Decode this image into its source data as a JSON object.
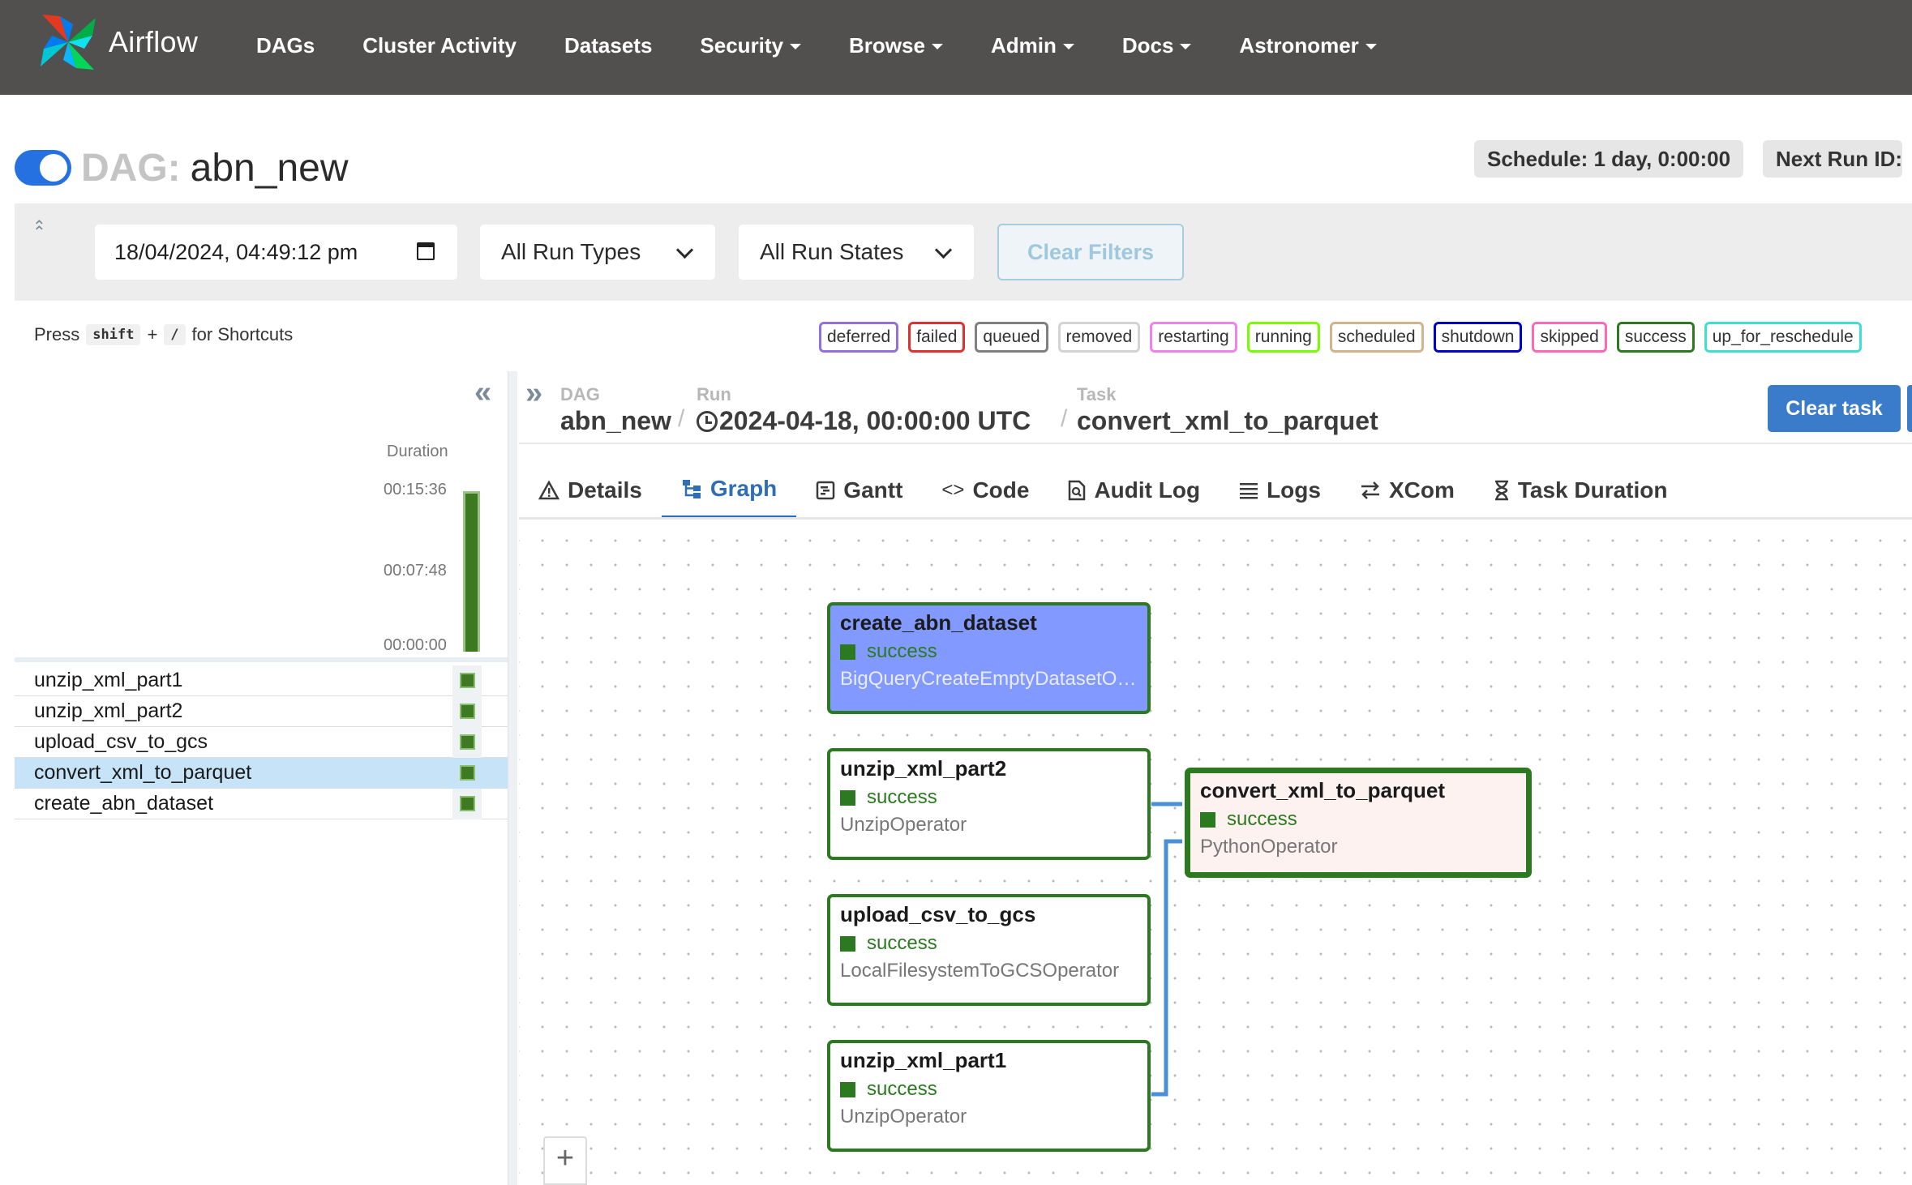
{
  "app": {
    "brand": "Airflow",
    "nav": [
      "DAGs",
      "Cluster Activity",
      "Datasets",
      "Security",
      "Browse",
      "Admin",
      "Docs",
      "Astronomer"
    ],
    "nav_dropdowns": [
      false,
      false,
      false,
      true,
      true,
      true,
      true,
      true
    ]
  },
  "dag": {
    "prefix": "DAG:",
    "name": "abn_new",
    "paused": false,
    "schedule": "Schedule: 1 day, 0:00:00",
    "next_run": "Next Run ID:"
  },
  "filters": {
    "date": "18/04/2024, 04:49:12 pm",
    "run_types": "All Run Types",
    "run_states": "All Run States",
    "clear_label": "Clear Filters"
  },
  "shortcuts": {
    "press": "Press",
    "key1": "shift",
    "plus": "+",
    "key2": "/",
    "suffix": "for Shortcuts"
  },
  "legend": [
    {
      "label": "deferred",
      "color": "#9370db"
    },
    {
      "label": "failed",
      "color": "#e03131"
    },
    {
      "label": "queued",
      "color": "#808080"
    },
    {
      "label": "removed",
      "color": "#d3d3d3"
    },
    {
      "label": "restarting",
      "color": "#ee82ee"
    },
    {
      "label": "running",
      "color": "#7cfc00"
    },
    {
      "label": "scheduled",
      "color": "#d2b48c"
    },
    {
      "label": "shutdown",
      "color": "#0000cc"
    },
    {
      "label": "skipped",
      "color": "#ff69b4"
    },
    {
      "label": "success",
      "color": "#2c7a1f"
    },
    {
      "label": "up_for_reschedule",
      "color": "#40e0d0"
    }
  ],
  "grid": {
    "duration_label": "Duration",
    "ticks": [
      "00:15:36",
      "00:07:48",
      "00:00:00"
    ],
    "tasks": [
      {
        "name": "unzip_xml_part1",
        "state": "success",
        "selected": false
      },
      {
        "name": "unzip_xml_part2",
        "state": "success",
        "selected": false
      },
      {
        "name": "upload_csv_to_gcs",
        "state": "success",
        "selected": false
      },
      {
        "name": "convert_xml_to_parquet",
        "state": "success",
        "selected": true
      },
      {
        "name": "create_abn_dataset",
        "state": "success",
        "selected": false
      }
    ]
  },
  "breadcrumb": {
    "dag_label": "DAG",
    "dag_value": "abn_new",
    "run_label": "Run",
    "run_value": "2024-04-18, 00:00:00 UTC",
    "task_label": "Task",
    "task_value": "convert_xml_to_parquet"
  },
  "actions": {
    "clear_task": "Clear task"
  },
  "tabs": [
    {
      "label": "Details",
      "icon": "warning-icon",
      "active": false
    },
    {
      "label": "Graph",
      "icon": "graph-icon",
      "active": true
    },
    {
      "label": "Gantt",
      "icon": "gantt-icon",
      "active": false
    },
    {
      "label": "Code",
      "icon": "code-icon",
      "active": false
    },
    {
      "label": "Audit Log",
      "icon": "audit-log-icon",
      "active": false
    },
    {
      "label": "Logs",
      "icon": "logs-icon",
      "active": false
    },
    {
      "label": "XCom",
      "icon": "xcom-icon",
      "active": false
    },
    {
      "label": "Task Duration",
      "icon": "hourglass-icon",
      "active": false
    }
  ],
  "graph": {
    "nodes": [
      {
        "id": "create_abn_dataset",
        "name": "create_abn_dataset",
        "state": "success",
        "operator": "BigQueryCreateEmptyDatasetO…"
      },
      {
        "id": "unzip_xml_part2",
        "name": "unzip_xml_part2",
        "state": "success",
        "operator": "UnzipOperator"
      },
      {
        "id": "upload_csv_to_gcs",
        "name": "upload_csv_to_gcs",
        "state": "success",
        "operator": "LocalFilesystemToGCSOperator"
      },
      {
        "id": "unzip_xml_part1",
        "name": "unzip_xml_part1",
        "state": "success",
        "operator": "UnzipOperator"
      },
      {
        "id": "convert_xml_to_parquet",
        "name": "convert_xml_to_parquet",
        "state": "success",
        "operator": "PythonOperator"
      }
    ],
    "edges": [
      {
        "from": "unzip_xml_part2",
        "to": "convert_xml_to_parquet"
      },
      {
        "from": "unzip_xml_part1",
        "to": "convert_xml_to_parquet"
      }
    ],
    "zoom_in": "+"
  }
}
